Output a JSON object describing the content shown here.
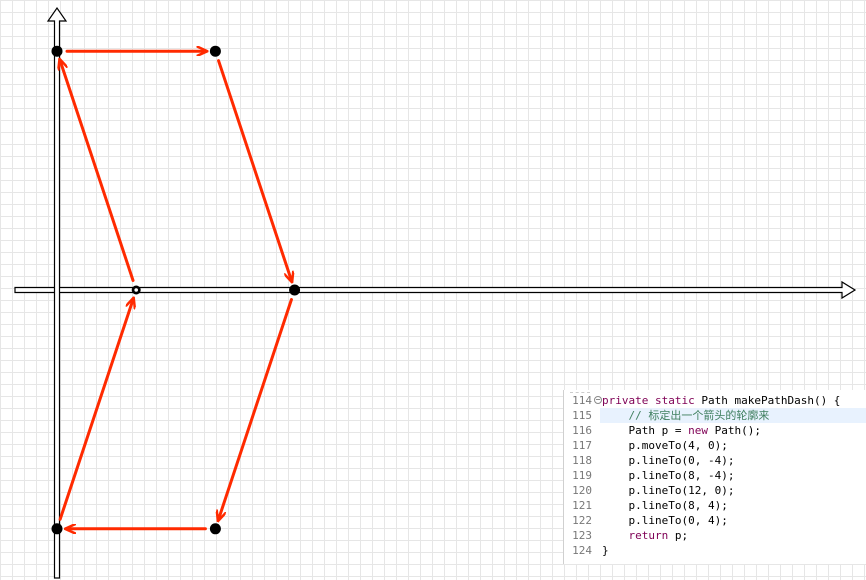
{
  "code": {
    "lines": [
      {
        "num": "114",
        "fold": true,
        "parts": [
          {
            "t": "private",
            "k": "kw"
          },
          {
            "t": " ",
            "k": "n"
          },
          {
            "t": "static",
            "k": "kw"
          },
          {
            "t": " Path makePathDash() {",
            "k": "n"
          }
        ]
      },
      {
        "num": "115",
        "highlight": true,
        "parts": [
          {
            "t": "    ",
            "k": "n"
          },
          {
            "t": "// 标定出一个箭头的轮廓来",
            "k": "cm"
          }
        ]
      },
      {
        "num": "116",
        "parts": [
          {
            "t": "    Path p = ",
            "k": "n"
          },
          {
            "t": "new",
            "k": "kw"
          },
          {
            "t": " Path();",
            "k": "n"
          }
        ]
      },
      {
        "num": "117",
        "parts": [
          {
            "t": "    p.moveTo(4, 0);",
            "k": "n"
          }
        ]
      },
      {
        "num": "118",
        "parts": [
          {
            "t": "    p.lineTo(0, -4);",
            "k": "n"
          }
        ]
      },
      {
        "num": "119",
        "parts": [
          {
            "t": "    p.lineTo(8, -4);",
            "k": "n"
          }
        ]
      },
      {
        "num": "120",
        "parts": [
          {
            "t": "    p.lineTo(12, 0);",
            "k": "n"
          }
        ]
      },
      {
        "num": "121",
        "parts": [
          {
            "t": "    p.lineTo(8, 4);",
            "k": "n"
          }
        ]
      },
      {
        "num": "122",
        "parts": [
          {
            "t": "    p.lineTo(0, 4);",
            "k": "n"
          }
        ]
      },
      {
        "num": "123",
        "parts": [
          {
            "t": "    ",
            "k": "n"
          },
          {
            "t": "return",
            "k": "kw"
          },
          {
            "t": " p;",
            "k": "n"
          }
        ]
      },
      {
        "num": "124",
        "parts": [
          {
            "t": "}",
            "k": "n"
          }
        ]
      }
    ]
  },
  "path_points": [
    {
      "x": 4,
      "y": 0,
      "hollow": true
    },
    {
      "x": 0,
      "y": -4
    },
    {
      "x": 8,
      "y": -4
    },
    {
      "x": 12,
      "y": 0
    },
    {
      "x": 8,
      "y": 4
    },
    {
      "x": 0,
      "y": 4
    }
  ],
  "colors": {
    "path": "#ff2a00",
    "point": "#000000",
    "axis": "#000000"
  }
}
